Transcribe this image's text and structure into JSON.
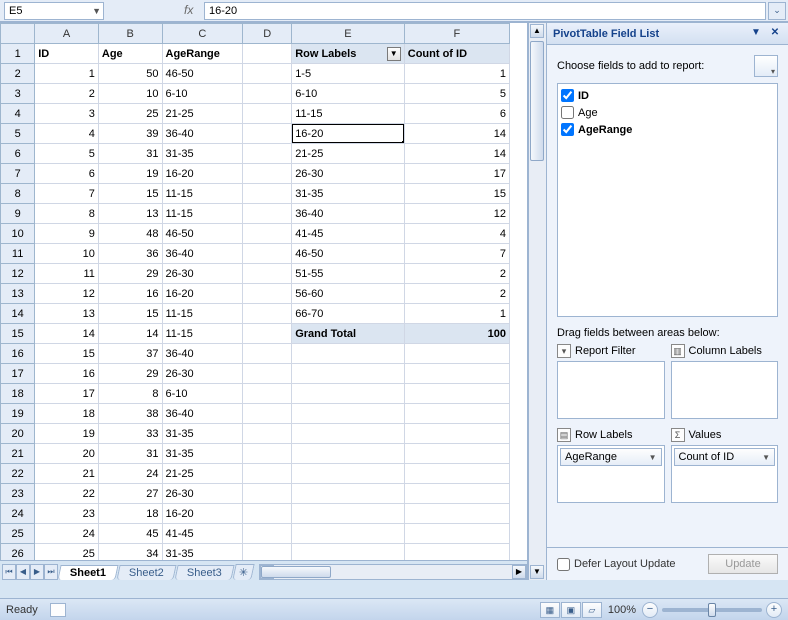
{
  "formula_bar": {
    "cell_ref": "E5",
    "fx_label": "fx",
    "value": "16-20"
  },
  "columns": [
    "A",
    "B",
    "C",
    "D",
    "E",
    "F"
  ],
  "headers": {
    "A": "ID",
    "B": "Age",
    "C": "AgeRange",
    "E": "Row Labels",
    "F": "Count of ID"
  },
  "data_rows": [
    {
      "r": 2,
      "id": 1,
      "age": 50,
      "range": "46-50"
    },
    {
      "r": 3,
      "id": 2,
      "age": 10,
      "range": "6-10"
    },
    {
      "r": 4,
      "id": 3,
      "age": 25,
      "range": "21-25"
    },
    {
      "r": 5,
      "id": 4,
      "age": 39,
      "range": "36-40"
    },
    {
      "r": 6,
      "id": 5,
      "age": 31,
      "range": "31-35"
    },
    {
      "r": 7,
      "id": 6,
      "age": 19,
      "range": "16-20"
    },
    {
      "r": 8,
      "id": 7,
      "age": 15,
      "range": "11-15"
    },
    {
      "r": 9,
      "id": 8,
      "age": 13,
      "range": "11-15"
    },
    {
      "r": 10,
      "id": 9,
      "age": 48,
      "range": "46-50"
    },
    {
      "r": 11,
      "id": 10,
      "age": 36,
      "range": "36-40"
    },
    {
      "r": 12,
      "id": 11,
      "age": 29,
      "range": "26-30"
    },
    {
      "r": 13,
      "id": 12,
      "age": 16,
      "range": "16-20"
    },
    {
      "r": 14,
      "id": 13,
      "age": 15,
      "range": "11-15"
    },
    {
      "r": 15,
      "id": 14,
      "age": 14,
      "range": "11-15"
    },
    {
      "r": 16,
      "id": 15,
      "age": 37,
      "range": "36-40"
    },
    {
      "r": 17,
      "id": 16,
      "age": 29,
      "range": "26-30"
    },
    {
      "r": 18,
      "id": 17,
      "age": 8,
      "range": "6-10"
    },
    {
      "r": 19,
      "id": 18,
      "age": 38,
      "range": "36-40"
    },
    {
      "r": 20,
      "id": 19,
      "age": 33,
      "range": "31-35"
    },
    {
      "r": 21,
      "id": 20,
      "age": 31,
      "range": "31-35"
    },
    {
      "r": 22,
      "id": 21,
      "age": 24,
      "range": "21-25"
    },
    {
      "r": 23,
      "id": 22,
      "age": 27,
      "range": "26-30"
    },
    {
      "r": 24,
      "id": 23,
      "age": 18,
      "range": "16-20"
    },
    {
      "r": 25,
      "id": 24,
      "age": 45,
      "range": "41-45"
    },
    {
      "r": 26,
      "id": 25,
      "age": 34,
      "range": "31-35"
    }
  ],
  "pivot_rows": [
    {
      "r": 2,
      "label": "1-5",
      "count": 1
    },
    {
      "r": 3,
      "label": "6-10",
      "count": 5
    },
    {
      "r": 4,
      "label": "11-15",
      "count": 6
    },
    {
      "r": 5,
      "label": "16-20",
      "count": 14
    },
    {
      "r": 6,
      "label": "21-25",
      "count": 14
    },
    {
      "r": 7,
      "label": "26-30",
      "count": 17
    },
    {
      "r": 8,
      "label": "31-35",
      "count": 15
    },
    {
      "r": 9,
      "label": "36-40",
      "count": 12
    },
    {
      "r": 10,
      "label": "41-45",
      "count": 4
    },
    {
      "r": 11,
      "label": "46-50",
      "count": 7
    },
    {
      "r": 12,
      "label": "51-55",
      "count": 2
    },
    {
      "r": 13,
      "label": "56-60",
      "count": 2
    },
    {
      "r": 14,
      "label": "66-70",
      "count": 1
    }
  ],
  "pivot_total": {
    "label": "Grand Total",
    "count": 100
  },
  "active_cell": {
    "row": 5,
    "col": "E"
  },
  "sheet_tabs": [
    "Sheet1",
    "Sheet2",
    "Sheet3"
  ],
  "active_tab": 0,
  "pane": {
    "title": "PivotTable Field List",
    "choose_label": "Choose fields to add to report:",
    "fields": [
      {
        "name": "ID",
        "checked": true,
        "bold": true
      },
      {
        "name": "Age",
        "checked": false,
        "bold": false
      },
      {
        "name": "AgeRange",
        "checked": true,
        "bold": true
      }
    ],
    "drag_label": "Drag fields between areas below:",
    "areas": {
      "report_filter": {
        "title": "Report Filter",
        "items": []
      },
      "column_labels": {
        "title": "Column Labels",
        "items": []
      },
      "row_labels": {
        "title": "Row Labels",
        "items": [
          "AgeRange"
        ]
      },
      "values": {
        "title": "Values",
        "items": [
          "Count of ID"
        ]
      }
    },
    "defer_label": "Defer Layout Update",
    "update_label": "Update"
  },
  "status": {
    "ready": "Ready",
    "zoom": "100%"
  }
}
